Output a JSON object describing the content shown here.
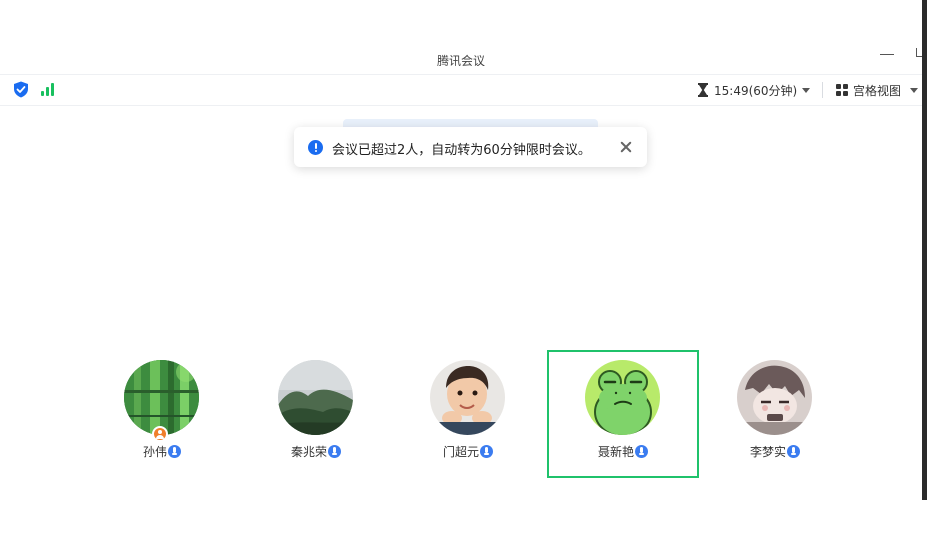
{
  "window": {
    "title": "腾讯会议"
  },
  "toolbar": {
    "timer_text": "15:49(60分钟)",
    "view_label": "宫格视图"
  },
  "toast": {
    "message": "会议已超过2人，自动转为60分钟限时会议。"
  },
  "participants": [
    {
      "name": "孙伟",
      "avatar": "bamboo-photo",
      "host": true,
      "active": false
    },
    {
      "name": "秦兆荣",
      "avatar": "misty-mountain-photo",
      "host": false,
      "active": false
    },
    {
      "name": "门超元",
      "avatar": "child-photo",
      "host": false,
      "active": false
    },
    {
      "name": "聂新艳",
      "avatar": "frog-cartoon",
      "host": false,
      "active": true
    },
    {
      "name": "李梦实",
      "avatar": "anime-girl-drawing",
      "host": false,
      "active": false
    }
  ],
  "colors": {
    "accent_blue": "#1a6cf0",
    "signal_green": "#19c05f",
    "active_speaker_border": "#1fc26b",
    "host_badge": "#f07f2b"
  }
}
